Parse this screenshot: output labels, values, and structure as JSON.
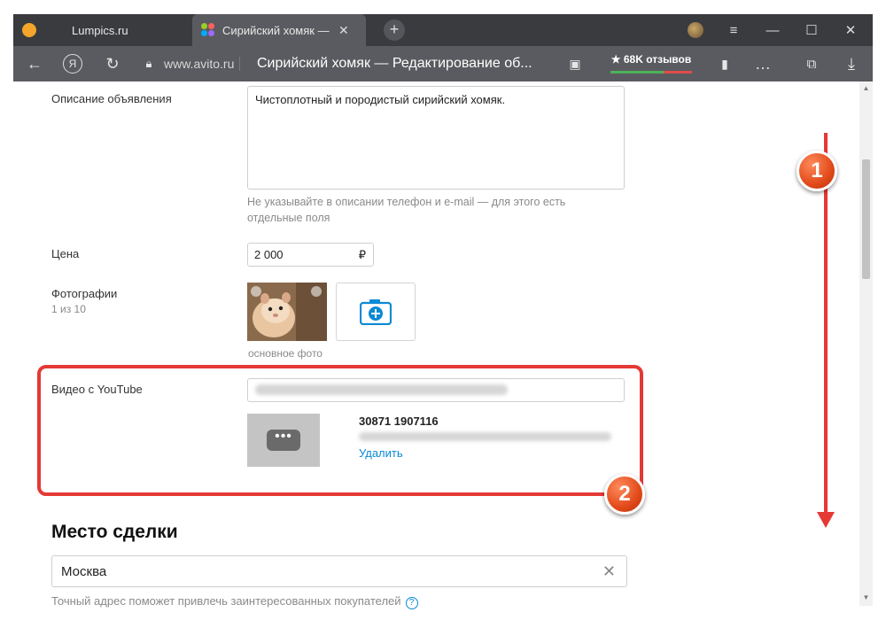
{
  "browser": {
    "tabs": [
      {
        "title": "Lumpics.ru"
      },
      {
        "title": "Сирийский хомяк — Ре"
      }
    ],
    "address": {
      "domain": "www.avito.ru",
      "title": "Сирийский хомяк — Редактирование об..."
    },
    "reviews_label": "★ 68K отзывов",
    "ext_badge": "1"
  },
  "form": {
    "description": {
      "label": "Описание объявления",
      "value": "Чистоплотный и породистый сирийский хомяк.",
      "hint": "Не указывайте в описании телефон и e-mail — для этого есть отдельные поля"
    },
    "price": {
      "label": "Цена",
      "value": "2 000",
      "currency": "₽"
    },
    "photos": {
      "label": "Фотографии",
      "count": "1 из 10",
      "main_caption": "основное фото"
    },
    "video": {
      "label": "Видео с YouTube",
      "thumb_icon": "•••",
      "title": "30871 1907116",
      "delete_label": "Удалить"
    }
  },
  "deal_place": {
    "heading": "Место сделки",
    "city": "Москва",
    "hint": "Точный адрес поможет привлечь заинтересованных покупателей",
    "help_icon": "?"
  },
  "annotations": {
    "badge1": "1",
    "badge2": "2",
    "color": "#e53935"
  }
}
